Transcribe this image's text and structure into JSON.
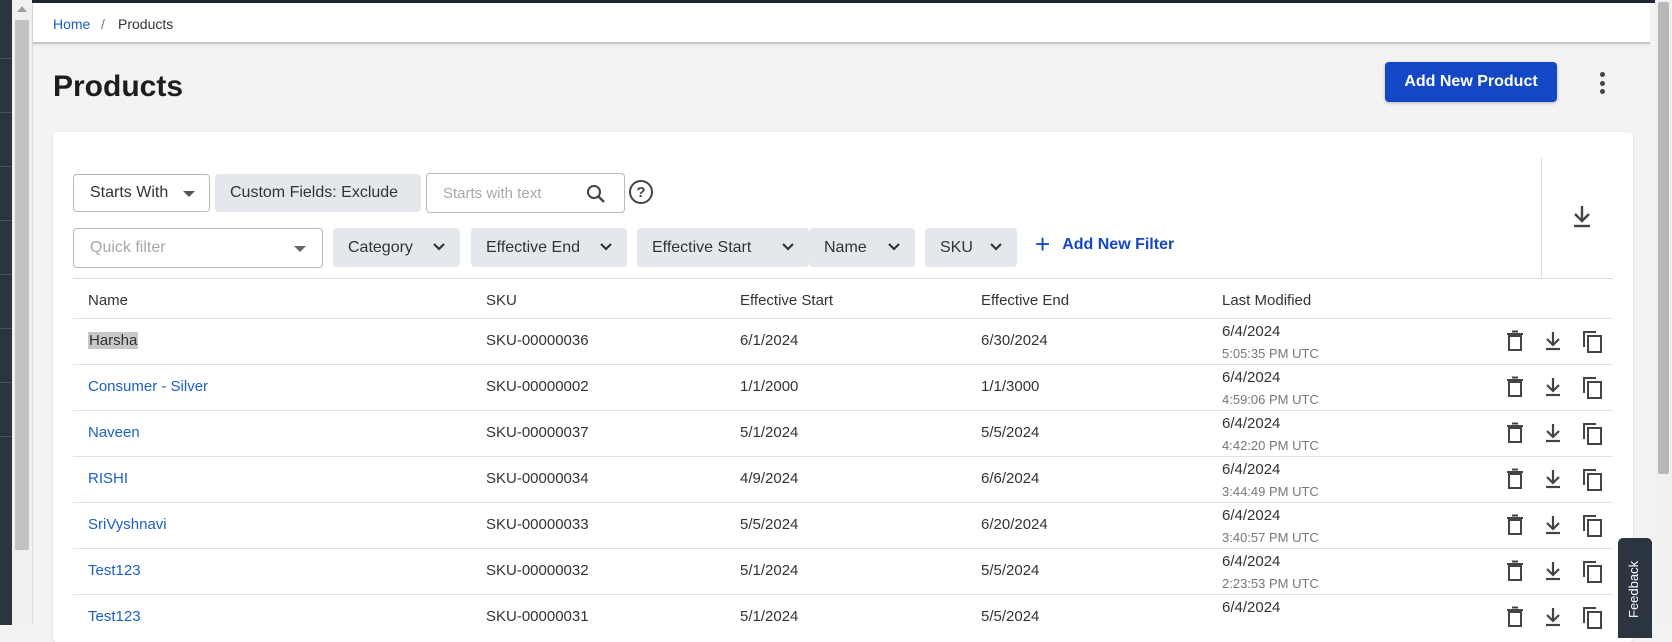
{
  "breadcrumb": {
    "home": "Home",
    "separator": "/",
    "current": "Products"
  },
  "page": {
    "title": "Products",
    "add_button": "Add New Product"
  },
  "toolbar": {
    "match_mode": "Starts With",
    "custom_fields": "Custom Fields: Exclude",
    "search_placeholder": "Starts with text",
    "help_glyph": "?",
    "quick_filter_placeholder": "Quick filter",
    "filters": [
      "Category",
      "Effective End",
      "Effective Start",
      "Name",
      "SKU"
    ],
    "add_filter": "Add New Filter",
    "add_filter_glyph": "+"
  },
  "table": {
    "columns": [
      "Name",
      "SKU",
      "Effective Start",
      "Effective End",
      "Last Modified"
    ],
    "rows": [
      {
        "name": "Harsha",
        "sku": "SKU-00000036",
        "start": "6/1/2024",
        "end": "6/30/2024",
        "mod_date": "6/4/2024",
        "mod_time": "5:05:35 PM UTC"
      },
      {
        "name": "Consumer - Silver",
        "sku": "SKU-00000002",
        "start": "1/1/2000",
        "end": "1/1/3000",
        "mod_date": "6/4/2024",
        "mod_time": "4:59:06 PM UTC"
      },
      {
        "name": "Naveen",
        "sku": "SKU-00000037",
        "start": "5/1/2024",
        "end": "5/5/2024",
        "mod_date": "6/4/2024",
        "mod_time": "4:42:20 PM UTC"
      },
      {
        "name": "RISHI",
        "sku": "SKU-00000034",
        "start": "4/9/2024",
        "end": "6/6/2024",
        "mod_date": "6/4/2024",
        "mod_time": "3:44:49 PM UTC"
      },
      {
        "name": "SriVyshnavi",
        "sku": "SKU-00000033",
        "start": "5/5/2024",
        "end": "6/20/2024",
        "mod_date": "6/4/2024",
        "mod_time": "3:40:57 PM UTC"
      },
      {
        "name": "Test123",
        "sku": "SKU-00000032",
        "start": "5/1/2024",
        "end": "5/5/2024",
        "mod_date": "6/4/2024",
        "mod_time": "2:23:53 PM UTC"
      },
      {
        "name": "Test123",
        "sku": "SKU-00000031",
        "start": "5/1/2024",
        "end": "5/5/2024",
        "mod_date": "6/4/2024",
        "mod_time": ""
      }
    ],
    "row_actions": [
      "trash-icon",
      "download-icon",
      "copy-icon"
    ]
  },
  "feedback_label": "Feedback",
  "colors": {
    "primary": "#1447c5",
    "link": "#1b5fc7",
    "chip_bg": "#e4e8ec",
    "rail": "#2b3540"
  }
}
